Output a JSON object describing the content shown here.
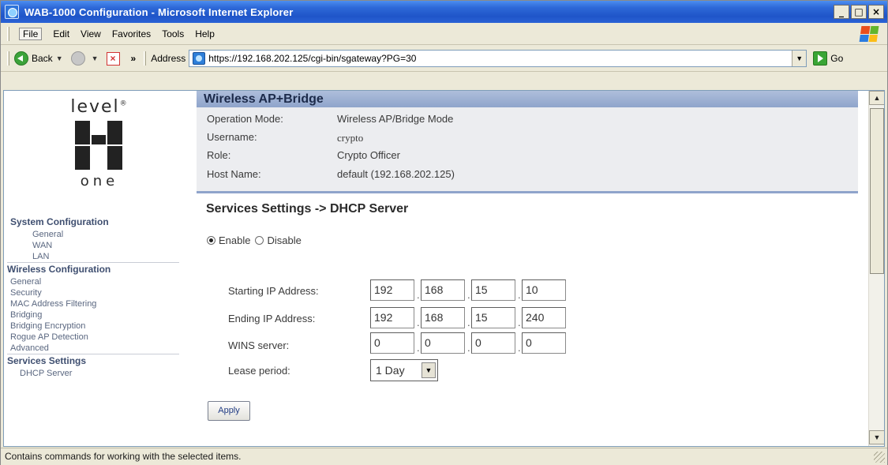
{
  "window": {
    "title": "WAB-1000 Configuration - Microsoft Internet Explorer",
    "min": "_",
    "max": "□",
    "close": "×"
  },
  "menu": [
    "File",
    "Edit",
    "View",
    "Favorites",
    "Tools",
    "Help"
  ],
  "toolbar": {
    "back_label": "Back",
    "more": "»",
    "address_label": "Address",
    "address_url": "https://192.168.202.125/cgi-bin/sgateway?PG=30",
    "go_label": "Go"
  },
  "sidebar": {
    "logo_top": "level",
    "logo_bottom": "one",
    "sections": [
      {
        "title": "System Configuration",
        "items": [
          "General",
          "WAN",
          "LAN"
        ]
      },
      {
        "title": "Wireless Configuration",
        "items": [
          "General",
          "Security",
          "MAC Address Filtering",
          "Bridging",
          "Bridging Encryption",
          "Rogue AP Detection",
          "Advanced"
        ]
      },
      {
        "title": "Services Settings",
        "items": [
          "DHCP Server"
        ]
      }
    ]
  },
  "main": {
    "banner": "Wireless AP+Bridge",
    "info": [
      {
        "label": "Operation Mode:",
        "value": "Wireless AP/Bridge Mode"
      },
      {
        "label": "Username:",
        "value": "crypto"
      },
      {
        "label": "Role:",
        "value": "Crypto Officer"
      },
      {
        "label": "Host Name:",
        "value": "default (192.168.202.125)"
      }
    ],
    "section_title": "Services Settings -> DHCP Server",
    "enable_label": "Enable",
    "disable_label": "Disable",
    "fields": [
      {
        "label": "Starting IP Address:",
        "octets": [
          "192",
          "168",
          "15",
          "10"
        ]
      },
      {
        "label": "Ending IP Address:",
        "octets": [
          "192",
          "168",
          "15",
          "240"
        ]
      },
      {
        "label": "WINS server:",
        "octets": [
          "0",
          "0",
          "0",
          "0"
        ]
      }
    ],
    "lease_label": "Lease period:",
    "lease_value": "1 Day",
    "apply_label": "Apply",
    "dot": "."
  },
  "status": {
    "text": "Contains commands for working with the selected items."
  }
}
